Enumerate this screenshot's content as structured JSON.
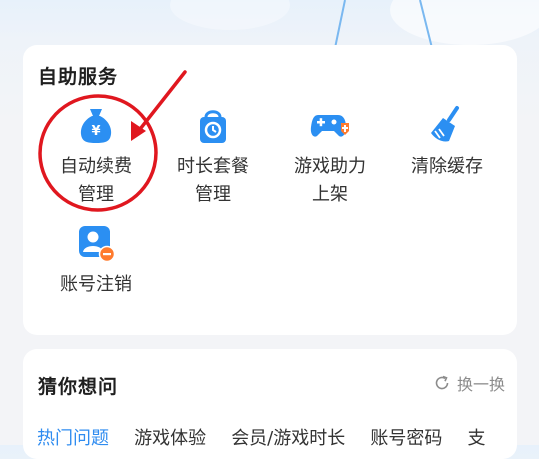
{
  "service": {
    "title": "自助服务",
    "items": [
      {
        "line1": "自动续费",
        "line2": "管理",
        "icon": "money-bag-icon"
      },
      {
        "line1": "时长套餐",
        "line2": "管理",
        "icon": "clock-bag-icon"
      },
      {
        "line1": "游戏助力",
        "line2": "上架",
        "icon": "gamepad-icon"
      },
      {
        "line1": "清除缓存",
        "line2": "",
        "icon": "broom-icon"
      },
      {
        "line1": "账号注销",
        "line2": "",
        "icon": "user-remove-icon"
      }
    ]
  },
  "faq": {
    "title": "猜你想问",
    "refresh": "换一换",
    "tabs": [
      "热门问题",
      "游戏体验",
      "会员/游戏时长",
      "账号密码",
      "支"
    ]
  },
  "colors": {
    "accent": "#2f8cf0",
    "icon_blue": "#2b8ff2",
    "icon_orange": "#ff7b2e",
    "annotation_red": "#e0171f"
  }
}
